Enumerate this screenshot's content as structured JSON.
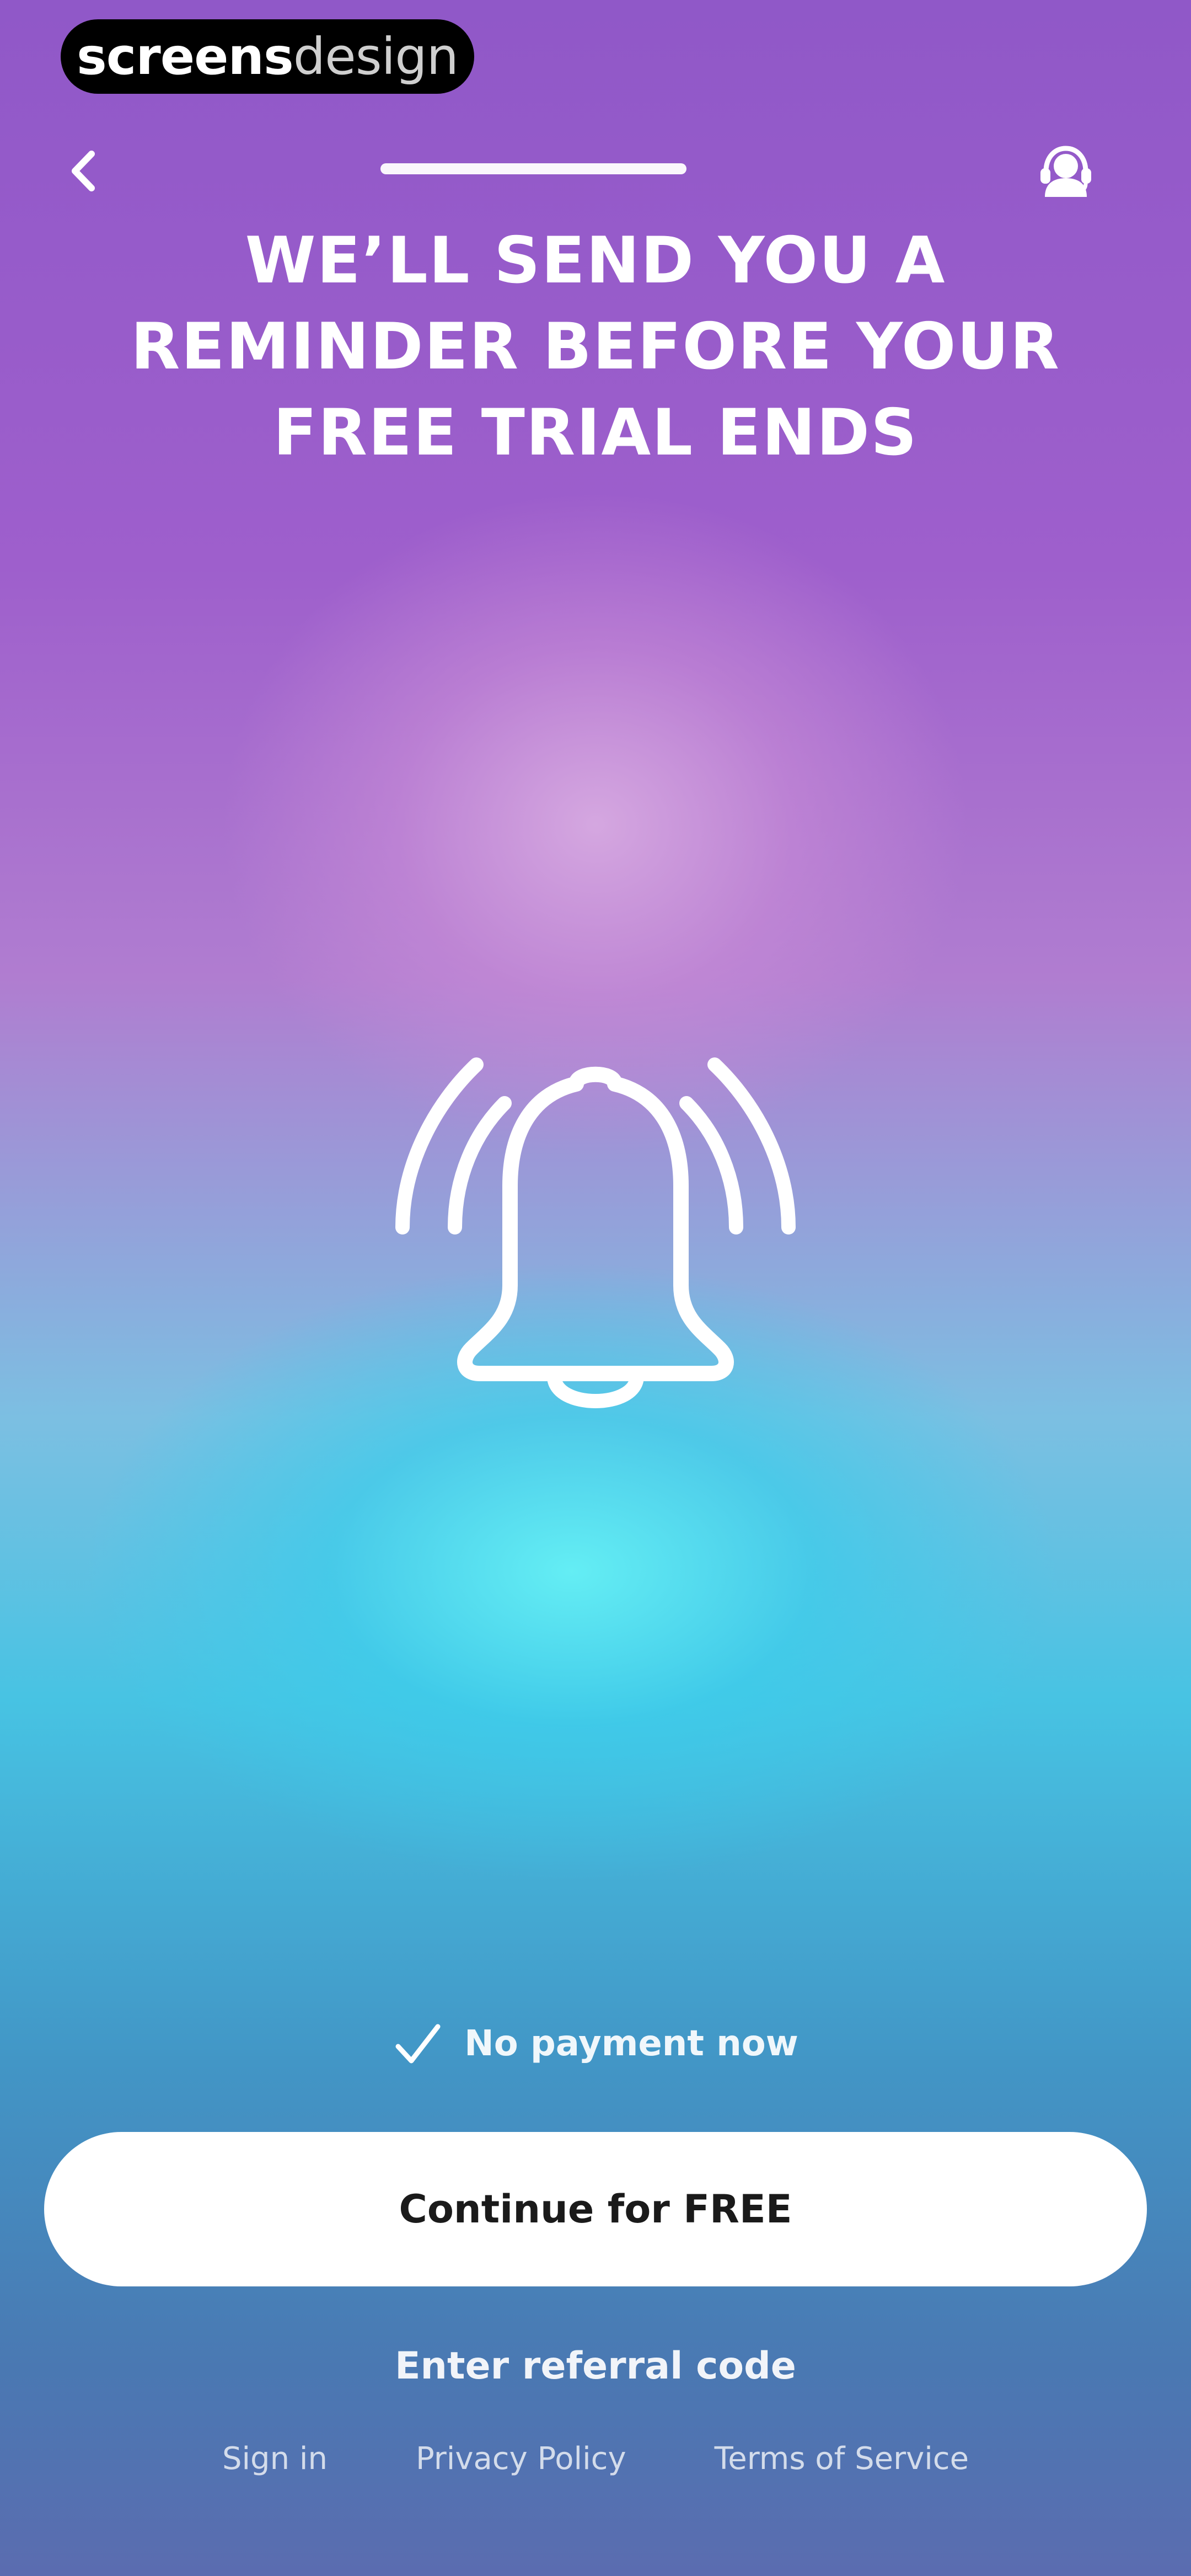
{
  "watermark": {
    "brand_bold": "screens",
    "brand_light": "design"
  },
  "header": {
    "back_icon": "chevron-left-icon",
    "support_icon": "support-agent-icon",
    "progress_fraction": 1.0
  },
  "headline": {
    "lines": [
      "WE’LL SEND YOU A",
      "REMINDER BEFORE YOUR",
      "FREE TRIAL ENDS"
    ]
  },
  "illustration": {
    "icon": "ringing-bell-icon"
  },
  "footer": {
    "no_payment_label": "No payment now",
    "cta_label": "Continue for FREE",
    "referral_label": "Enter referral code",
    "links": {
      "sign_in": "Sign in",
      "privacy": "Privacy Policy",
      "terms": "Terms of Service"
    }
  },
  "colors": {
    "accent_top": "#9058c8",
    "accent_mid": "#47c3e3",
    "accent_bottom": "#4a78b2",
    "cta_bg": "#ffffff",
    "cta_text": "#1a1a1a"
  }
}
